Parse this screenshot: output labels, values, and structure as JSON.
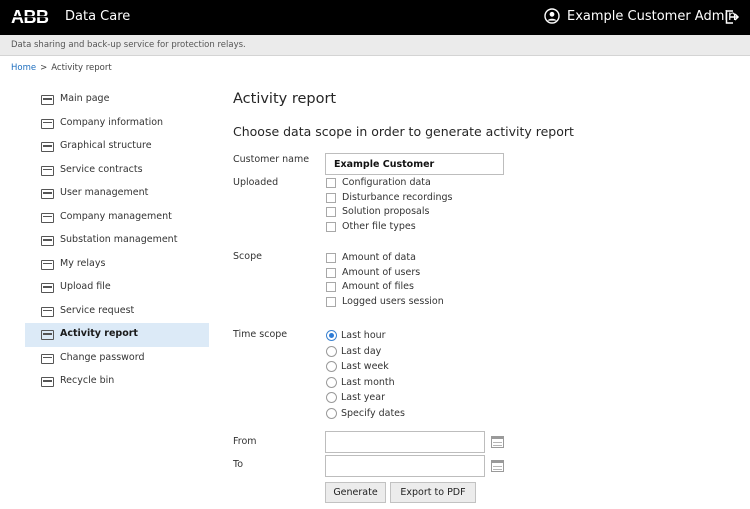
{
  "header": {
    "logo_text": "ABB",
    "app_name": "Data Care",
    "user_name": "Example Customer Admin",
    "icons": {
      "user": "user-circle-icon",
      "logout": "logout-icon"
    }
  },
  "subheader": {
    "tagline": "Data sharing and back-up service for protection relays."
  },
  "breadcrumb": {
    "home": "Home",
    "separator": ">",
    "current": "Activity report"
  },
  "sidebar": {
    "items": [
      {
        "label": "Main page",
        "active": false
      },
      {
        "label": "Company information",
        "active": false
      },
      {
        "label": "Graphical structure",
        "active": false
      },
      {
        "label": "Service contracts",
        "active": false
      },
      {
        "label": "User management",
        "active": false
      },
      {
        "label": "Company management",
        "active": false
      },
      {
        "label": "Substation management",
        "active": false
      },
      {
        "label": "My relays",
        "active": false
      },
      {
        "label": "Upload file",
        "active": false
      },
      {
        "label": "Service request",
        "active": false
      },
      {
        "label": "Activity report",
        "active": true
      },
      {
        "label": "Change password",
        "active": false
      },
      {
        "label": "Recycle bin",
        "active": false
      }
    ]
  },
  "main": {
    "title": "Activity report",
    "subtitle": "Choose data scope in order to generate activity report",
    "customer_name": {
      "label": "Customer name",
      "value": "Example Customer"
    },
    "uploaded": {
      "label": "Uploaded",
      "options": [
        {
          "label": "Configuration data",
          "checked": false
        },
        {
          "label": "Disturbance recordings",
          "checked": false
        },
        {
          "label": "Solution proposals",
          "checked": false
        },
        {
          "label": "Other file types",
          "checked": false
        }
      ]
    },
    "scope": {
      "label": "Scope",
      "options": [
        {
          "label": "Amount of data",
          "checked": false
        },
        {
          "label": "Amount of users",
          "checked": false
        },
        {
          "label": "Amount of files",
          "checked": false
        },
        {
          "label": "Logged users session",
          "checked": false
        }
      ]
    },
    "time_scope": {
      "label": "Time scope",
      "options": [
        {
          "label": "Last hour",
          "selected": true
        },
        {
          "label": "Last day",
          "selected": false
        },
        {
          "label": "Last week",
          "selected": false
        },
        {
          "label": "Last month",
          "selected": false
        },
        {
          "label": "Last year",
          "selected": false
        },
        {
          "label": "Specify dates",
          "selected": false
        }
      ]
    },
    "from": {
      "label": "From",
      "value": ""
    },
    "to": {
      "label": "To",
      "value": ""
    },
    "buttons": {
      "generate": "Generate",
      "export": "Export to PDF"
    }
  },
  "colors": {
    "topbar_bg": "#000000",
    "subbar_bg": "#ebebeb",
    "link": "#1f6fbf",
    "active_item_bg": "#dceaf7",
    "abb_red": "#ff000f",
    "radio_selected": "#2d7bd6"
  }
}
